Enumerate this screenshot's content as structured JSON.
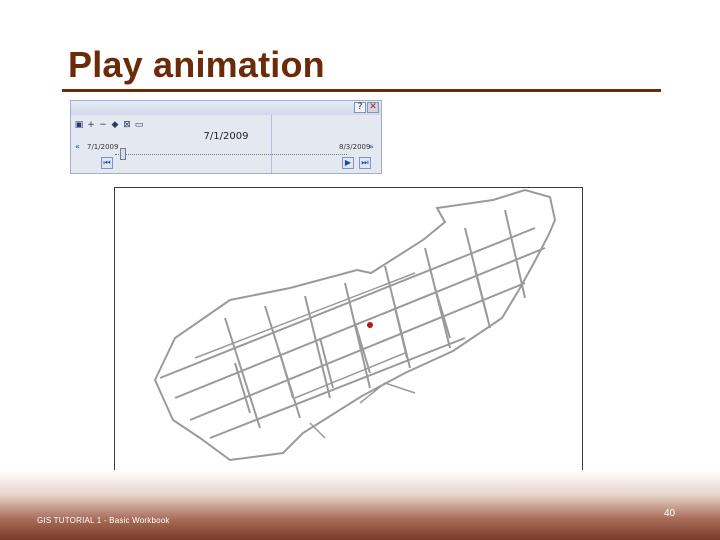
{
  "slide": {
    "title": "Play animation",
    "footer": "GIS TUTORIAL 1 - Basic Workbook",
    "page_number": "40"
  },
  "time_slider": {
    "help_label": "?",
    "close_label": "✕",
    "toolbar_icons": [
      "options-icon",
      "zoom-in-icon",
      "zoom-out-icon",
      "time-window-icon",
      "export-icon",
      "copy-icon"
    ],
    "current_date": "7/1/2009",
    "start_label": "7/1/2009",
    "end_label": "8/3/2009",
    "prev_label": "«",
    "next_label": "»",
    "position": 0.02
  },
  "map": {
    "highlight_color": "#c0121d",
    "street_color": "#9a9a9a"
  },
  "colors": {
    "title": "#6b2a08",
    "footer_dark": "#7a3a28"
  }
}
